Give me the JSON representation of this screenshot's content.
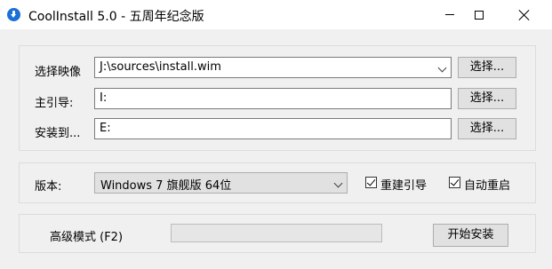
{
  "window": {
    "title": "CoolInstall 5.0 - 五周年纪念版"
  },
  "image_row": {
    "label": "选择映像",
    "value": "J:\\sources\\install.wim",
    "button": "选择..."
  },
  "boot_row": {
    "label": "主引导:",
    "value": "I:",
    "button": "选择..."
  },
  "install_row": {
    "label": "安装到...",
    "value": "E:",
    "button": "选择..."
  },
  "version_row": {
    "label": "版本:",
    "selected": "Windows 7 旗舰版  64位",
    "rebuild_boot": {
      "label": "重建引导",
      "checked": true
    },
    "auto_restart": {
      "label": "自动重启",
      "checked": true
    }
  },
  "bottom_row": {
    "advanced_label": "高级模式 (F2)",
    "progress_percent": 0,
    "start_button": "开始安装"
  },
  "colors": {
    "progress_fill": "#06b025",
    "app_icon": "#1b6fd6"
  },
  "icons": [
    "app-download-icon",
    "minimize-icon",
    "maximize-icon",
    "close-icon",
    "dropdown-arrow-icon",
    "checkmark-icon"
  ]
}
